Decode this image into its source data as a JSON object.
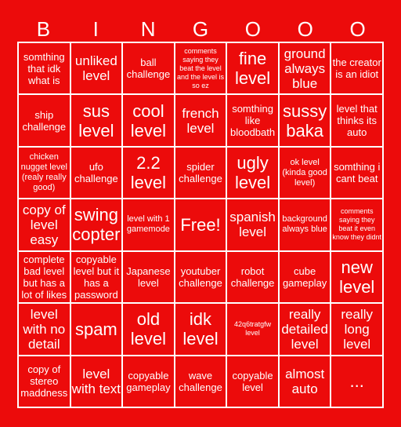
{
  "header": {
    "letters": [
      "B",
      "I",
      "N",
      "G",
      "O",
      "O",
      "O"
    ]
  },
  "colors": {
    "background": "#ec0b0b",
    "text": "#ffffff",
    "grid_lines": "#ffffff"
  },
  "rows": [
    [
      {
        "text": "somthing that idk what is",
        "size": "md"
      },
      {
        "text": "unliked level",
        "size": "lg"
      },
      {
        "text": "ball challenge",
        "size": "md"
      },
      {
        "text": "comments saying they beat the level and the level is so ez",
        "size": "xs"
      },
      {
        "text": "fine level",
        "size": "xl"
      },
      {
        "text": "ground always blue",
        "size": "lg"
      },
      {
        "text": "the creator is an idiot",
        "size": "md"
      }
    ],
    [
      {
        "text": "ship challenge",
        "size": "md"
      },
      {
        "text": "sus level",
        "size": "xl"
      },
      {
        "text": "cool level",
        "size": "xl"
      },
      {
        "text": "french level",
        "size": "lg"
      },
      {
        "text": "somthing like bloodbath",
        "size": "md"
      },
      {
        "text": "sussy baka",
        "size": "xl"
      },
      {
        "text": "level that thinks its auto",
        "size": "md"
      }
    ],
    [
      {
        "text": "chicken nugget level (realy really good)",
        "size": "sm"
      },
      {
        "text": "ufo challenge",
        "size": "md"
      },
      {
        "text": "2.2 level",
        "size": "xl"
      },
      {
        "text": "spider challenge",
        "size": "md"
      },
      {
        "text": "ugly level",
        "size": "xl"
      },
      {
        "text": "ok level (kinda good level)",
        "size": "sm"
      },
      {
        "text": "somthing i cant beat",
        "size": "md"
      }
    ],
    [
      {
        "text": "copy of level easy",
        "size": "lg"
      },
      {
        "text": "swing copter",
        "size": "xl"
      },
      {
        "text": "level with 1 gamemode",
        "size": "sm"
      },
      {
        "text": "Free!",
        "size": "xl"
      },
      {
        "text": "spanish level",
        "size": "lg"
      },
      {
        "text": "background always blue",
        "size": "sm"
      },
      {
        "text": "comments saying they beat it even know they didnt",
        "size": "xs"
      }
    ],
    [
      {
        "text": "complete bad level but has a lot of likes",
        "size": "md"
      },
      {
        "text": "copyable level but it has a password",
        "size": "md"
      },
      {
        "text": "Japanese level",
        "size": "md"
      },
      {
        "text": "youtuber challenge",
        "size": "md"
      },
      {
        "text": "robot challenge",
        "size": "md"
      },
      {
        "text": "cube gameplay",
        "size": "md"
      },
      {
        "text": "new level",
        "size": "xl"
      }
    ],
    [
      {
        "text": "level with no detail",
        "size": "lg"
      },
      {
        "text": "spam",
        "size": "xl"
      },
      {
        "text": "old level",
        "size": "xl"
      },
      {
        "text": "idk level",
        "size": "xl"
      },
      {
        "text": "42q6tratgfw level",
        "size": "xs"
      },
      {
        "text": "really detailed level",
        "size": "lg"
      },
      {
        "text": "really long level",
        "size": "lg"
      }
    ],
    [
      {
        "text": "copy of stereo maddness",
        "size": "md"
      },
      {
        "text": "level with text",
        "size": "lg"
      },
      {
        "text": "copyable gameplay",
        "size": "md"
      },
      {
        "text": "wave challenge",
        "size": "md"
      },
      {
        "text": "copyable level",
        "size": "md"
      },
      {
        "text": "almost auto",
        "size": "lg"
      },
      {
        "text": "...",
        "size": "xl"
      }
    ]
  ]
}
